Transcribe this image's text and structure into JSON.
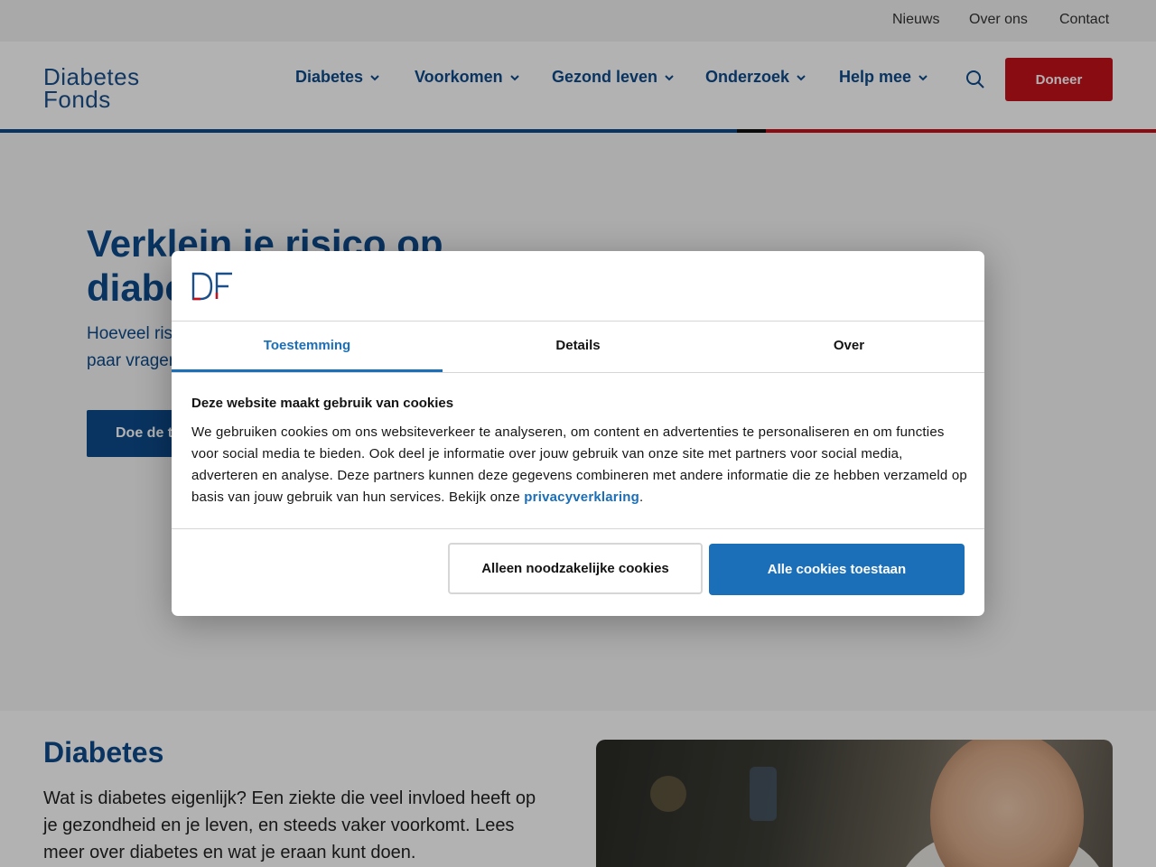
{
  "topbar": {
    "links": [
      "Nieuws",
      "Over ons",
      "Contact"
    ]
  },
  "header": {
    "logo": {
      "line1": "Diabetes",
      "line2": "Fonds"
    },
    "nav": [
      "Diabetes",
      "Voorkomen",
      "Gezond leven",
      "Onderzoek",
      "Help mee"
    ],
    "donate_label": "Doneer"
  },
  "hero": {
    "title": "Verklein je risico op diabetes",
    "text": "Hoeveel risico loop jij op diabetes type 2? Beantwoord een paar vragen.",
    "button_label": "Doe de test"
  },
  "section": {
    "title": "Diabetes",
    "text": "Wat is diabetes eigenlijk? Een ziekte die veel invloed heeft op je gezondheid en je leven, en steeds vaker voorkomt. Lees meer over diabetes en wat je eraan kunt doen."
  },
  "cookie": {
    "logo_text": "DF",
    "tabs": [
      "Toestemming",
      "Details",
      "Over"
    ],
    "heading": "Deze website maakt gebruik van cookies",
    "body": "We gebruiken cookies om ons websiteverkeer te analyseren, om content en advertenties te personaliseren en om functies voor social media te bieden. Ook deel je informatie over jouw gebruik van onze site met partners voor social media, adverteren en analyse. Deze partners kunnen deze gegevens combineren met andere informatie die ze hebben verzameld op basis van jouw gebruik van hun services. Bekijk onze ",
    "link": "privacyverklaring",
    "after_link": ".",
    "btn_necessary": "Alleen noodzakelijke cookies",
    "btn_all": "Alle cookies toestaan"
  },
  "colors": {
    "brand_blue": "#0d4a8a",
    "brand_red": "#c4121c",
    "cookie_blue": "#1a6fb8"
  },
  "icons": [
    "chevron-down-icon",
    "search-icon"
  ]
}
